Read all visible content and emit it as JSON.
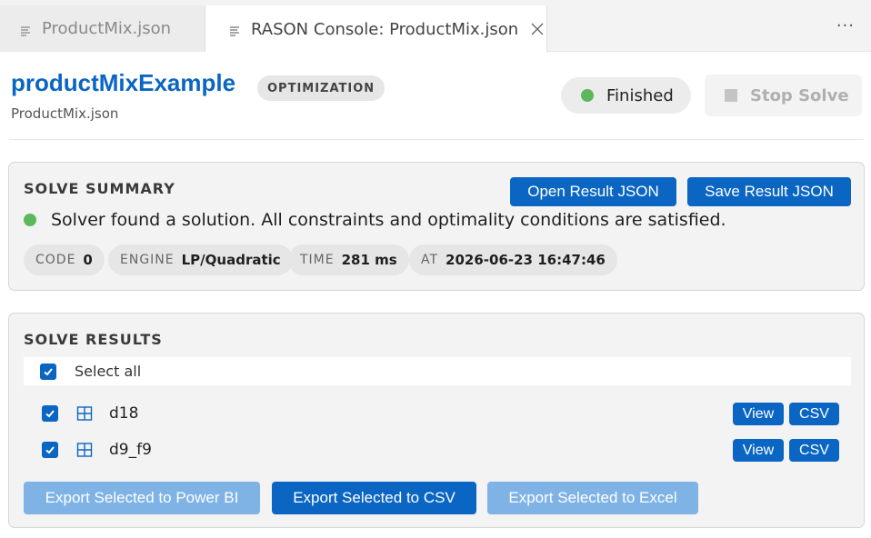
{
  "tabs": [
    {
      "label": "ProductMix.json"
    },
    {
      "label": "RASON Console: ProductMix.json"
    }
  ],
  "more_label": "···",
  "header": {
    "title": "productMixExample",
    "badge": "OPTIMIZATION",
    "subtitle": "ProductMix.json",
    "status": "Finished",
    "stop_label": "Stop Solve"
  },
  "summary": {
    "title": "SOLVE SUMMARY",
    "open_label": "Open Result JSON",
    "save_label": "Save Result JSON",
    "message": "Solver found a solution. All constraints and optimality conditions are satisfied.",
    "chips": [
      {
        "key": "CODE",
        "value": "0"
      },
      {
        "key": "ENGINE",
        "value": "LP/Quadratic"
      },
      {
        "key": "TIME",
        "value": "281 ms"
      },
      {
        "key": "AT",
        "value": "2026-06-23 16:47:46"
      }
    ]
  },
  "results": {
    "title": "SOLVE RESULTS",
    "select_all": "Select all",
    "rows": [
      {
        "name": "d18",
        "view": "View",
        "csv": "CSV"
      },
      {
        "name": "d9_f9",
        "view": "View",
        "csv": "CSV"
      }
    ],
    "export_powerbi": "Export Selected to Power BI",
    "export_csv": "Export Selected to CSV",
    "export_excel": "Export Selected to Excel"
  },
  "colors": {
    "accent": "#0a66c2",
    "status_green": "#5cb85c",
    "disabled_blue": "#7fb3e6"
  }
}
